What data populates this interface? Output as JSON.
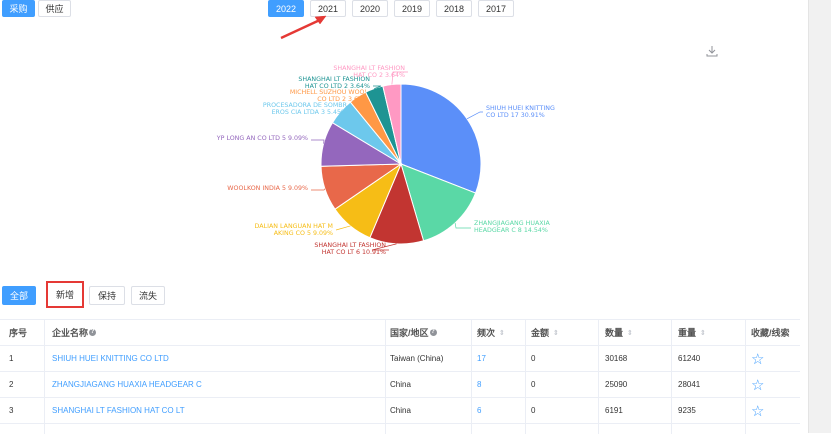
{
  "top_tabs": [
    {
      "label": "采购",
      "active": true
    },
    {
      "label": "供应",
      "active": false
    }
  ],
  "years": [
    {
      "label": "2022",
      "active": true
    },
    {
      "label": "2021",
      "active": false
    },
    {
      "label": "2020",
      "active": false
    },
    {
      "label": "2019",
      "active": false
    },
    {
      "label": "2018",
      "active": false
    },
    {
      "label": "2017",
      "active": false
    }
  ],
  "chart_data": {
    "type": "pie",
    "title": "",
    "slices": [
      {
        "label": "SHIUH HUEI KNITTING CO LTD 17 30.91%",
        "value": 30.91,
        "color": "#5b8ff9"
      },
      {
        "label": "ZHANGJIAGANG HUAXIA HEADGEAR C 8 14.54%",
        "value": 14.54,
        "color": "#5ad8a6"
      },
      {
        "label": "SHANGHAI LT FASHION HAT CO LT 6 10.91%",
        "value": 10.91,
        "color": "#c23531"
      },
      {
        "label": "DALIAN LANGUAN HAT MAKING CO 5 9.09%",
        "value": 9.09,
        "color": "#f6bd16"
      },
      {
        "label": "WOOLKON INDIA 5 9.09%",
        "value": 9.09,
        "color": "#e8684a"
      },
      {
        "label": "YP LONG AN CO LTD 5 9.09%",
        "value": 9.09,
        "color": "#9467bd"
      },
      {
        "label": "PROCESADORA DE SOMBREROS CIA LTDA 3 5.45%",
        "value": 5.45,
        "color": "#6dc8ec"
      },
      {
        "label": "MICHELL SUZHOU WOOL CO LTD 2 3.64%",
        "value": 3.64,
        "color": "#ff9845"
      },
      {
        "label": "SHANGHAI LT FASHION HAT CO LTD 2 3.64%",
        "value": 3.64,
        "color": "#1e9493"
      },
      {
        "label": "SHANGHAI LT FASHION HAT CO 2 3.64%",
        "value": 3.64,
        "color": "#ff99c3"
      }
    ],
    "label_texts": [
      [
        "SHIUH HUEI KNITTING",
        "CO LTD 17 30.91%"
      ],
      [
        "ZHANGJIAGANG HUAXIA",
        "HEADGEAR C 8 14.54%"
      ],
      [
        "SHANGHAI LT FASHION",
        "HAT CO LT 6 10.91%"
      ],
      [
        "DALIAN LANGUAN HAT M",
        "AKING CO 5 9.09%"
      ],
      [
        "WOOLKON INDIA  5  9.09%"
      ],
      [
        "YP LONG AN CO LTD  5  9.09%"
      ],
      [
        "PROCESADORA DE SOMBR",
        "EROS CIA LTDA 3 5.45%"
      ],
      [
        "MICHELL SUZHOU WOOL",
        "CO LTD 2 3.64%"
      ],
      [
        "SHANGHAI LT FASHION",
        "HAT CO LTD 2 3.64%"
      ],
      [
        "SHANGHAI LT FASHION",
        "HAT CO 2 3.64%"
      ]
    ]
  },
  "filters": [
    {
      "label": "全部",
      "active": true
    },
    {
      "label": "新增",
      "active": false
    },
    {
      "label": "保持",
      "active": false
    },
    {
      "label": "流失",
      "active": false
    }
  ],
  "table": {
    "headers": {
      "index": "序号",
      "company": "企业名称",
      "country": "国家/地区",
      "frequency": "频次",
      "amount": "金额",
      "quantity": "数量",
      "weight": "重量",
      "favorite": "收藏/线索"
    },
    "rows": [
      {
        "index": "1",
        "company": "SHIUH HUEI KNITTING CO LTD",
        "country": "Taiwan (China)",
        "frequency": "17",
        "amount": "0",
        "quantity": "30168",
        "weight": "61240"
      },
      {
        "index": "2",
        "company": "ZHANGJIAGANG HUAXIA HEADGEAR C",
        "country": "China",
        "frequency": "8",
        "amount": "0",
        "quantity": "25090",
        "weight": "28041"
      },
      {
        "index": "3",
        "company": "SHANGHAI LT FASHION HAT CO LT",
        "country": "China",
        "frequency": "6",
        "amount": "0",
        "quantity": "6191",
        "weight": "9235"
      }
    ]
  },
  "colors": {
    "accent": "#409eff",
    "annotation": "#e53935"
  }
}
